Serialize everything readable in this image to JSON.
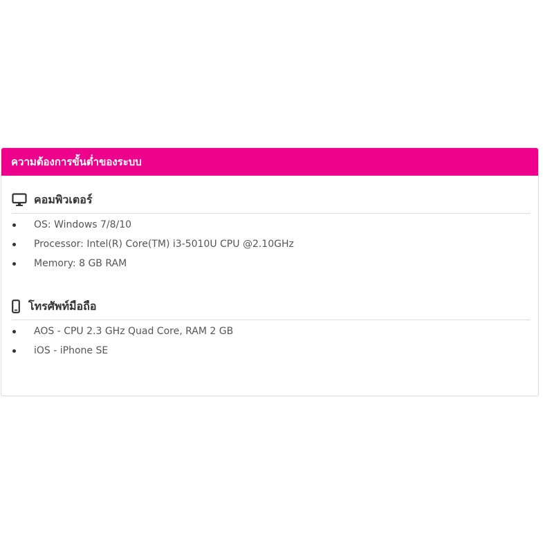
{
  "card": {
    "title": "ความต้องการขั้นต่ำของระบบ",
    "accent_color": "#ec008c"
  },
  "sections": [
    {
      "icon": "monitor-icon",
      "title": "คอมพิวเตอร์",
      "items": [
        "OS: Windows 7/8/10",
        "Processor: Intel(R) Core(TM) i3-5010U CPU @2.10GHz",
        "Memory: 8 GB RAM"
      ]
    },
    {
      "icon": "smartphone-icon",
      "title": "โทรศัพท์มือถือ",
      "items": [
        "AOS - CPU 2.3 GHz Quad Core, RAM 2 GB",
        "iOS - iPhone SE"
      ]
    }
  ]
}
